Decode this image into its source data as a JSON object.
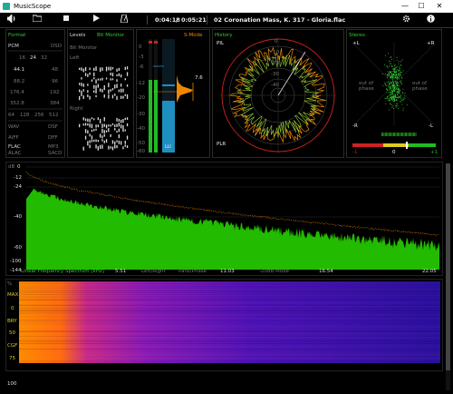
{
  "window": {
    "title": "MusicScope",
    "minimize": "—",
    "maximize": "☐",
    "close": "✕"
  },
  "toolbar": {
    "elapsed": "0:04:18",
    "divider": "/",
    "total": "0:05:21",
    "track": "02 Coronation Mass, K. 317 - Gloria.flac",
    "icons": [
      "volume-icon",
      "folder-icon",
      "stop-icon",
      "play-icon",
      "metronome-icon",
      "gear-icon",
      "info-icon"
    ]
  },
  "format": {
    "title": "Format",
    "header_left": "PCM",
    "header_right": "DSD",
    "rates": [
      [
        "",
        "16",
        "24",
        "32"
      ],
      [
        "44.1",
        "",
        "",
        "48"
      ],
      [
        "88.2",
        "",
        "",
        "96"
      ],
      [
        "176.4",
        "",
        "",
        "192"
      ],
      [
        "352.8",
        "",
        "",
        "384"
      ]
    ],
    "dsd": [
      "64",
      "128",
      "256",
      "512"
    ],
    "types": [
      [
        "WAV",
        "DSF"
      ],
      [
        "AIFF",
        "DFF"
      ],
      [
        "FLAC",
        "MP3"
      ],
      [
        "ALAC",
        "SACD"
      ]
    ]
  },
  "levels": {
    "title": "Levels",
    "bitmonitor": "Bit Monitor",
    "bitmonitor_sub": "Bit Monitor",
    "left": "Left",
    "right": "Right"
  },
  "meter": {
    "scale": [
      "0",
      "-3",
      "-6",
      "-12",
      "-20",
      "-30",
      "-40",
      "-50",
      "-60"
    ],
    "smode": "S-Mode",
    "readout": "7.6",
    "lu": "LU"
  },
  "history": {
    "title": "History",
    "pil": "PIL",
    "plr": "PLR",
    "ticks": [
      "0",
      "-10",
      "-20",
      "-30",
      "-40"
    ]
  },
  "stereo": {
    "title": "Stereo",
    "plus_l": "+L",
    "plus_r": "+R",
    "minus_l": "-R",
    "minus_r": "-L",
    "oop_left": "out of phase",
    "oop_right": "out of phase",
    "corr": [
      "-1",
      "0",
      "+1"
    ]
  },
  "spectrum": {
    "db": "dB",
    "ticks": [
      "0",
      "-12",
      "-24",
      "-40",
      "-60",
      "-100",
      "-144"
    ],
    "xlabels": [
      "Linear Frequency Spectrum [kHz]",
      "5.51",
      "Left/Right",
      "Pans/Phase",
      "11.03",
      "-20dB Mode",
      "16.54",
      "22.05"
    ]
  },
  "spectrogram": {
    "labels": [
      "%",
      "MAX",
      "0",
      "BRY",
      "50",
      "CGF",
      "75",
      "100"
    ]
  },
  "colors": {
    "accent_green": "#33cc33",
    "accent_orange": "#ee8800",
    "accent_red": "#cc2222"
  }
}
